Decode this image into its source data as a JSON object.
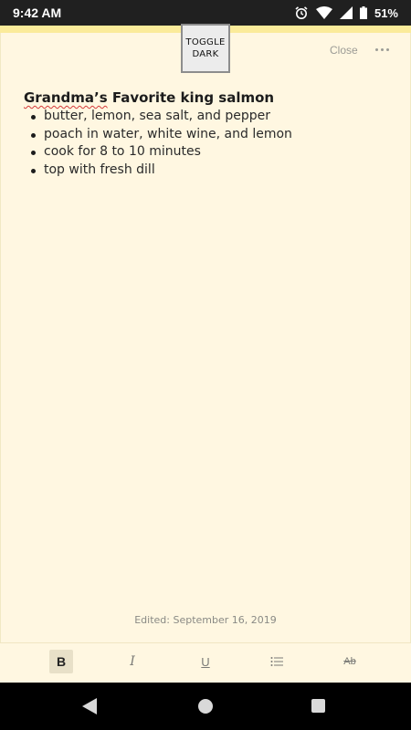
{
  "status_bar": {
    "time": "9:42 AM",
    "battery_text": "51%",
    "icons": [
      "alarm-icon",
      "wifi-icon",
      "cell-signal-icon",
      "battery-icon"
    ]
  },
  "header": {
    "toggle_line1": "TOGGLE",
    "toggle_line2": "DARK",
    "close_label": "Close",
    "more_icon": "more-horizontal-icon"
  },
  "note": {
    "title_prefix": "Grandma’s",
    "title_rest": " Favorite king salmon",
    "items": [
      "butter, lemon, sea salt, and pepper",
      "poach in water, white wine, and lemon",
      "cook for 8 to 10 minutes",
      "top with fresh dill"
    ],
    "edited": "Edited: September 16, 2019"
  },
  "toolbar": {
    "bold": "B",
    "italic": "I",
    "underline": "U",
    "strikethrough": "Ab",
    "bullets_icon": "bullet-list-icon"
  },
  "nav": {
    "icons": [
      "back-icon",
      "home-icon",
      "recents-icon"
    ]
  },
  "colors": {
    "note_background": "#fff7e1",
    "header_accent": "#fbeb9a",
    "status_bar": "#202020"
  }
}
